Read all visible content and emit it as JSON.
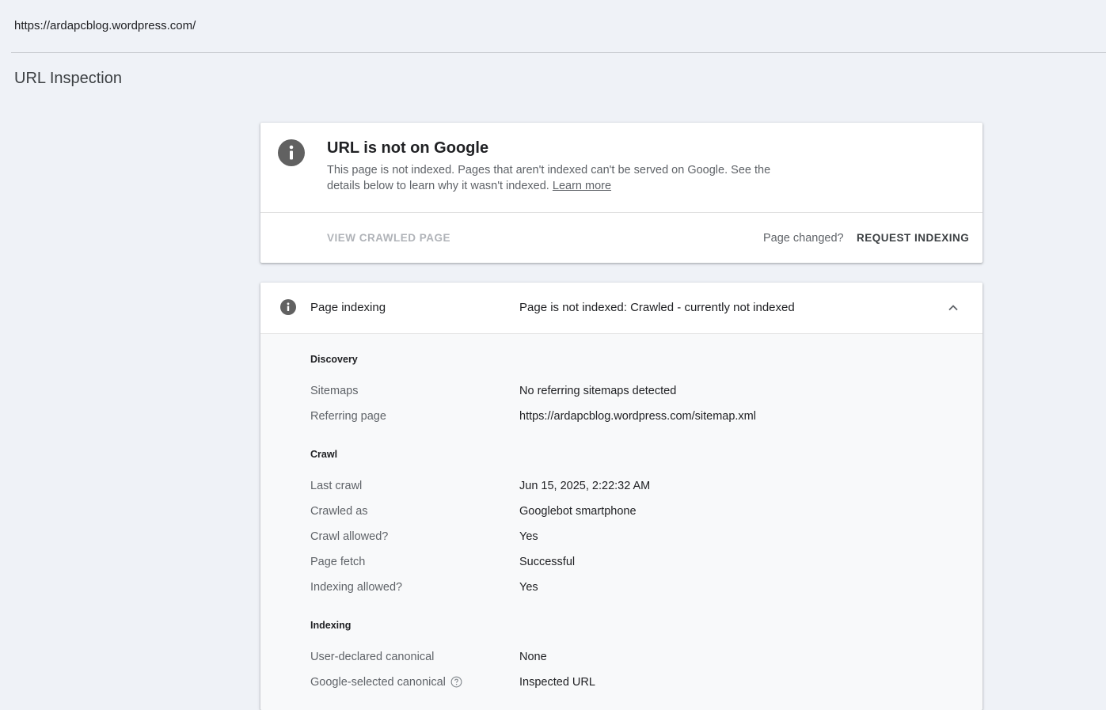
{
  "url_bar": {
    "text": "https://ardapcblog.wordpress.com/"
  },
  "page": {
    "title": "URL Inspection"
  },
  "status_card": {
    "title": "URL is not on Google",
    "description": "This page is not indexed. Pages that aren't indexed can't be served on Google. See the details below to learn why it wasn't indexed.",
    "learn_more": "Learn more",
    "view_crawled_label": "VIEW CRAWLED PAGE",
    "page_changed_label": "Page changed?",
    "request_indexing_label": "REQUEST INDEXING",
    "icon": "info-icon"
  },
  "indexing_card": {
    "header_label": "Page indexing",
    "header_value": "Page is not indexed: Crawled - currently not indexed",
    "icon": "info-icon",
    "chevron": "chevron-up-icon",
    "discovery": {
      "heading": "Discovery",
      "rows": [
        {
          "label": "Sitemaps",
          "value": "No referring sitemaps detected"
        },
        {
          "label": "Referring page",
          "value": "https://ardapcblog.wordpress.com/sitemap.xml"
        }
      ]
    },
    "crawl": {
      "heading": "Crawl",
      "rows": [
        {
          "label": "Last crawl",
          "value": "Jun 15, 2025, 2:22:32 AM"
        },
        {
          "label": "Crawled as",
          "value": "Googlebot smartphone"
        },
        {
          "label": "Crawl allowed?",
          "value": "Yes"
        },
        {
          "label": "Page fetch",
          "value": "Successful"
        },
        {
          "label": "Indexing allowed?",
          "value": "Yes"
        }
      ]
    },
    "indexing": {
      "heading": "Indexing",
      "rows": [
        {
          "label": "User-declared canonical",
          "value": "None"
        },
        {
          "label": "Google-selected canonical",
          "value": "Inspected URL",
          "help_icon": "help-circle-icon"
        }
      ]
    }
  }
}
